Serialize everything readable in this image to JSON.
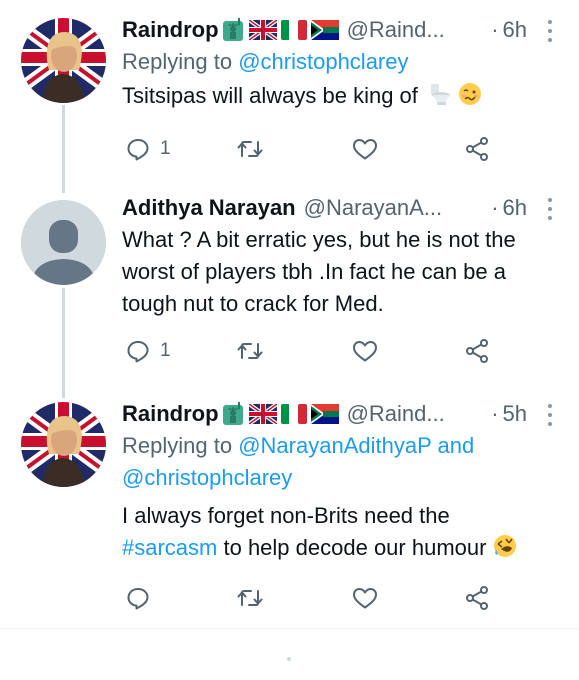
{
  "tweets": [
    {
      "name": "Raindrop",
      "handle": "@Raind...",
      "time": "6h",
      "replying_prefix": "Replying to",
      "mentions": [
        "@christophclarey"
      ],
      "text": "Tsitsipas will always be king of",
      "emojis": [
        "toilet-emoji",
        "woozy-face-emoji"
      ],
      "reply_count": "1",
      "retweet_count": "",
      "like_count": ""
    },
    {
      "name": "Adithya Narayan",
      "handle": "@NarayanA...",
      "time": "6h",
      "text_lines": [
        "What ? A bit erratic yes, but he is not the",
        "worst of players tbh .In fact he can be a",
        "tough nut to crack for Med."
      ],
      "reply_count": "1",
      "retweet_count": "",
      "like_count": ""
    },
    {
      "name": "Raindrop",
      "handle": "@Raind...",
      "time": "5h",
      "replying_prefix": "Replying to",
      "mentions": [
        "@NarayanAdithyaP",
        "@christophclarey"
      ],
      "and_word": "and",
      "text_line1": "I always forget non-Brits need the",
      "hashtag": "#sarcasm",
      "text_line2_rest": "to help decode our humour",
      "emojis": [
        "rolling-on-floor-laughing-emoji"
      ],
      "reply_count": "",
      "retweet_count": "",
      "like_count": ""
    }
  ],
  "icons": {
    "reply": "reply-icon",
    "retweet": "retweet-icon",
    "like": "like-icon",
    "share": "share-icon",
    "more": "more-icon"
  },
  "colors": {
    "link": "#1d9bf0",
    "secondary_text": "#536471",
    "thread_line": "#cfd9de"
  }
}
